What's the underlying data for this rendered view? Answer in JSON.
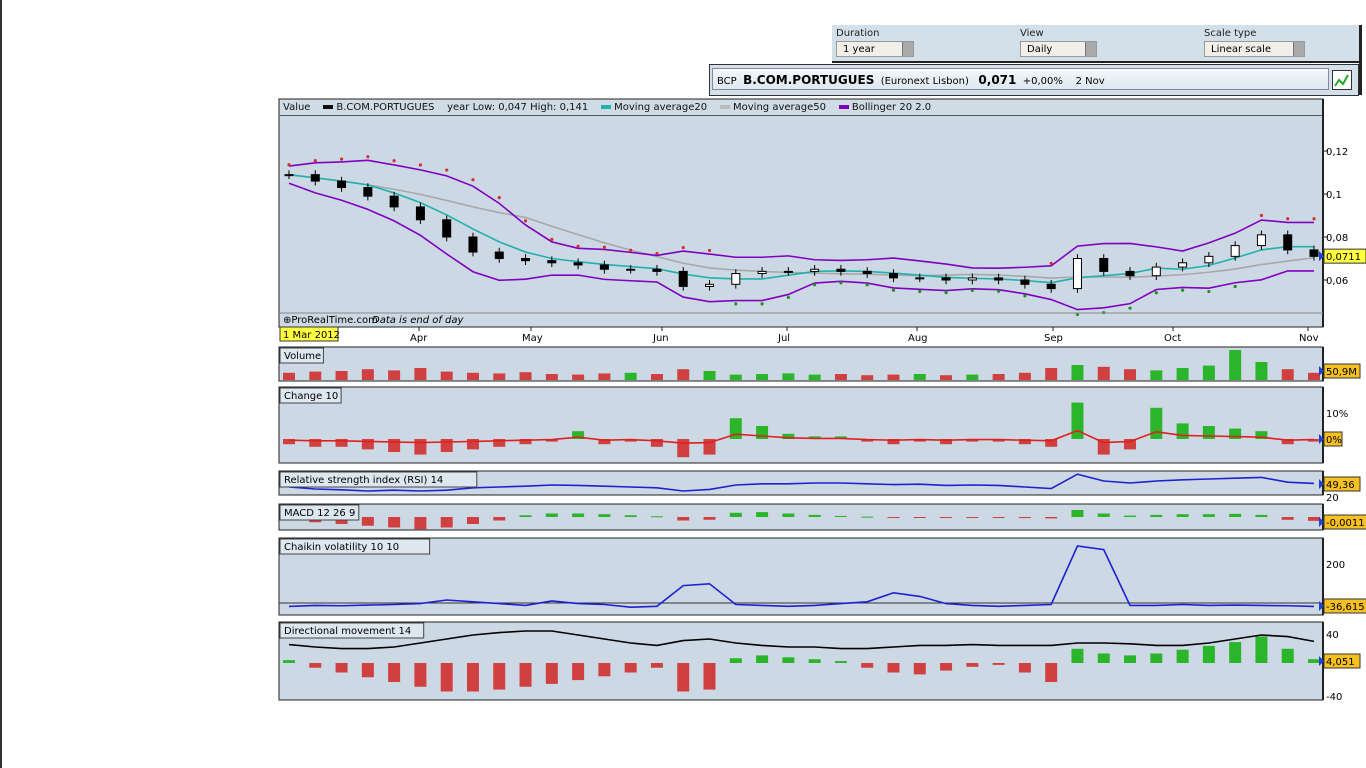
{
  "controls": {
    "duration_label": "Duration",
    "duration_value": "1 year",
    "view_label": "View",
    "view_value": "Daily",
    "scale_label": "Scale type",
    "scale_value": "Linear scale"
  },
  "ticker": {
    "code": "BCP",
    "name": "B.COM.PORTUGUES",
    "exchange": "(Euronext Lisbon)",
    "price": "0,071",
    "change": "+0,00%",
    "date": "2 Nov"
  },
  "legend": {
    "value": "Value",
    "instrument": "B.COM.PORTUGUES",
    "range": "year Low: 0,047 High: 0,141",
    "ma20": "Moving average20",
    "ma50": "Moving average50",
    "boll": "Bollinger 20 2.0"
  },
  "footer": {
    "source": "ProRealTime.com",
    "note": "Data is end of day",
    "start_date": "1 Mar 2012"
  },
  "colors": {
    "panel": "#ccd9e4",
    "up": "#2ab52a",
    "down": "#d04040",
    "ma20": "#20b0b0",
    "ma50": "#a8a8a8",
    "boll": "#8000c0",
    "line": "#2020d0",
    "sar_down": "#d03030",
    "sar_up": "#209020"
  },
  "chart_data": {
    "type": "line",
    "title": "B.COM.PORTUGUES daily",
    "months": [
      "Apr",
      "May",
      "Jun",
      "Jul",
      "Aug",
      "Sep",
      "Oct",
      "Nov"
    ],
    "price": {
      "yticks": [
        "0,12",
        "0,1",
        "0,08",
        "0,06"
      ],
      "ytick_values": [
        0.12,
        0.1,
        0.08,
        0.06
      ],
      "last_label": "0,0711",
      "close": [
        0.109,
        0.106,
        0.103,
        0.099,
        0.094,
        0.088,
        0.08,
        0.073,
        0.07,
        0.069,
        0.068,
        0.067,
        0.065,
        0.065,
        0.064,
        0.057,
        0.058,
        0.063,
        0.064,
        0.064,
        0.065,
        0.064,
        0.063,
        0.061,
        0.061,
        0.06,
        0.061,
        0.06,
        0.058,
        0.056,
        0.07,
        0.064,
        0.062,
        0.066,
        0.068,
        0.071,
        0.076,
        0.081,
        0.074,
        0.071
      ]
    },
    "panels": [
      {
        "name": "volume",
        "title": "Volume",
        "last_label": "50,9M",
        "values": [
          12,
          14,
          15,
          18,
          16,
          20,
          14,
          12,
          11,
          13,
          10,
          9,
          11,
          12,
          10,
          18,
          15,
          9,
          10,
          11,
          9,
          10,
          8,
          9,
          10,
          8,
          9,
          10,
          12,
          20,
          25,
          22,
          18,
          16,
          20,
          24,
          50,
          30,
          18,
          12
        ]
      },
      {
        "name": "change",
        "title": "Change 10",
        "tick": "10%",
        "last_label": "0%",
        "values": [
          -2,
          -3,
          -3,
          -4,
          -5,
          -6,
          -5,
          -4,
          -3,
          -2,
          -1,
          3,
          -2,
          -1,
          -3,
          -7,
          -6,
          8,
          5,
          2,
          1,
          1,
          -1,
          -2,
          -1,
          -2,
          -1,
          -1,
          -2,
          -3,
          14,
          -6,
          -4,
          12,
          6,
          5,
          4,
          3,
          -2,
          -1
        ]
      },
      {
        "name": "rsi",
        "title": "Relative strength index (RSI) 14",
        "tick": "20",
        "last_label": "49,36",
        "values": [
          40,
          35,
          33,
          30,
          32,
          30,
          32,
          38,
          40,
          42,
          45,
          44,
          42,
          40,
          38,
          30,
          34,
          45,
          48,
          48,
          50,
          50,
          48,
          46,
          47,
          44,
          45,
          44,
          40,
          36,
          72,
          55,
          50,
          55,
          58,
          60,
          62,
          64,
          52,
          49
        ]
      },
      {
        "name": "macd",
        "title": "MACD 12 26 9",
        "last_label": "-0,0011",
        "values": [
          -0.001,
          -0.0015,
          -0.002,
          -0.0025,
          -0.003,
          -0.0035,
          -0.003,
          -0.002,
          -0.001,
          0.0005,
          0.001,
          0.001,
          0.0008,
          0.0005,
          0.0002,
          -0.001,
          -0.0008,
          0.0012,
          0.0014,
          0.001,
          0.0006,
          0.0003,
          0.0001,
          -0.0002,
          -0.0002,
          -0.0002,
          -0.0001,
          -0.0002,
          -0.0003,
          -0.0004,
          0.002,
          0.001,
          0.0004,
          0.0006,
          0.0008,
          0.0008,
          0.0009,
          0.0006,
          -0.0008,
          -0.0011
        ]
      },
      {
        "name": "chaikin",
        "title": "Chaikin volatility 10 10",
        "tick": "200",
        "last_label": "-36,615",
        "values": [
          -36,
          -30,
          -32,
          -28,
          -25,
          -20,
          0,
          -10,
          -20,
          -30,
          -5,
          -20,
          -25,
          -40,
          -35,
          80,
          90,
          -25,
          -30,
          -35,
          -30,
          -20,
          -10,
          40,
          20,
          -20,
          -30,
          -35,
          -30,
          -25,
          300,
          280,
          -30,
          -30,
          -25,
          -30,
          -28,
          -30,
          -32,
          -36
        ]
      },
      {
        "name": "dm",
        "title": "Directional movement 14",
        "tick_top": "40",
        "tick_bottom": "-40",
        "last_label": "4,051",
        "adx": [
          23,
          20,
          18,
          18,
          20,
          25,
          30,
          35,
          38,
          40,
          40,
          35,
          30,
          25,
          22,
          28,
          30,
          25,
          22,
          20,
          20,
          18,
          18,
          20,
          22,
          22,
          23,
          22,
          22,
          22,
          25,
          25,
          24,
          22,
          22,
          25,
          30,
          35,
          33,
          27
        ],
        "dm": [
          3,
          -5,
          -10,
          -15,
          -20,
          -25,
          -30,
          -30,
          -28,
          -25,
          -22,
          -18,
          -14,
          -10,
          -5,
          -30,
          -28,
          5,
          8,
          6,
          4,
          2,
          -5,
          -10,
          -12,
          -8,
          -4,
          -2,
          -10,
          -20,
          15,
          10,
          8,
          10,
          14,
          18,
          22,
          28,
          15,
          4
        ]
      }
    ]
  }
}
